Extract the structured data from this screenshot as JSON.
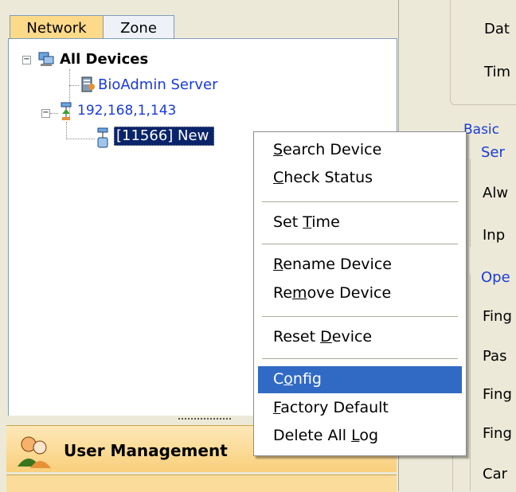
{
  "tabs": {
    "network": "Network",
    "zone": "Zone"
  },
  "tree": {
    "root": "All Devices",
    "server": "BioAdmin Server",
    "ip_node": "192,168,1,143",
    "selected_device": "[11566] New"
  },
  "sidebar_sections": {
    "user_management": "User Management"
  },
  "right_panel": {
    "labels": [
      "Dat",
      "Tim"
    ],
    "basic_group": "Basic",
    "ser": "Ser",
    "alw": "Alw",
    "inp": "Inp",
    "ope": "Ope",
    "items": [
      "Fing",
      "Pas",
      "Fing",
      "Fing",
      "Car"
    ]
  },
  "context_menu": {
    "search_device": {
      "pre": "",
      "u": "S",
      "post": "earch Device"
    },
    "check_status": {
      "pre": "",
      "u": "C",
      "post": "heck Status"
    },
    "set_time": {
      "pre": "Set ",
      "u": "T",
      "post": "ime"
    },
    "rename_device": {
      "pre": "",
      "u": "R",
      "post": "ename Device"
    },
    "remove_device": {
      "pre": "Re",
      "u": "m",
      "post": "ove Device"
    },
    "reset_device": {
      "pre": "Reset ",
      "u": "D",
      "post": "evice"
    },
    "config": {
      "pre": "C",
      "u": "o",
      "post": "nfig"
    },
    "factory_default": {
      "pre": "",
      "u": "F",
      "post": "actory Default"
    },
    "delete_all_log": {
      "pre": "Delete All ",
      "u": "L",
      "post": "og"
    }
  },
  "colors": {
    "selection": "#316ac5",
    "tree_selection": "#0a246a",
    "link_blue": "#1a3bd6",
    "active_tab": "#fdd98a"
  }
}
